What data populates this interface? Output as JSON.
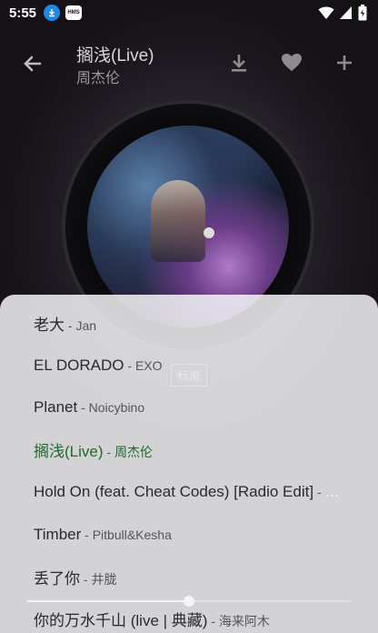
{
  "status": {
    "time": "5:55",
    "badges": [
      "download-icon",
      "hms-icon"
    ],
    "hms_label": "HMS",
    "right_icons": [
      "wifi-icon",
      "signal-icon",
      "battery-icon"
    ]
  },
  "player": {
    "title": "搁浅(Live)",
    "artist": "周杰伦",
    "actions": [
      "download-icon",
      "heart-icon",
      "plus-icon"
    ],
    "lyrics_tag": "标准",
    "progress": 0.5
  },
  "playlist": {
    "items": [
      {
        "title": "老大",
        "artist": "Jan"
      },
      {
        "title": "EL DORADO",
        "artist": "EXO"
      },
      {
        "title": "Planet",
        "artist": "Noicybino"
      },
      {
        "title": "搁浅(Live)",
        "artist": "周杰伦",
        "current": true
      },
      {
        "title": "Hold On (feat. Cheat Codes) [Radio Edit]",
        "artist": "M..."
      },
      {
        "title": "Timber",
        "artist": "Pitbull&Kesha"
      },
      {
        "title": "丢了你",
        "artist": "井胧"
      },
      {
        "title": "你的万水千山 (live | 典藏)",
        "artist": "海来阿木"
      }
    ],
    "current_color": "#1f6b2a"
  }
}
